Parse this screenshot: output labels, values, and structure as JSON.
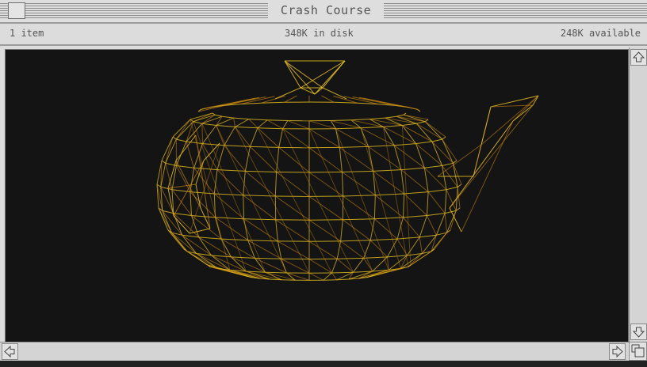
{
  "window": {
    "title": "Crash Course"
  },
  "info_bar": {
    "items": "1 item",
    "disk": "348K in disk",
    "available": "248K available"
  },
  "icons": {
    "close": "close-box-icon",
    "scroll_up": "arrow-up-icon",
    "scroll_down": "arrow-down-icon",
    "scroll_left": "arrow-left-icon",
    "scroll_right": "arrow-right-icon",
    "grow": "grow-box-icon",
    "content": "teapot-wireframe-icon"
  },
  "colors": {
    "wireframe": "#e8c020",
    "wireframe_dim": "#c08010",
    "background": "#141414",
    "chrome": "#dcdcdc"
  }
}
